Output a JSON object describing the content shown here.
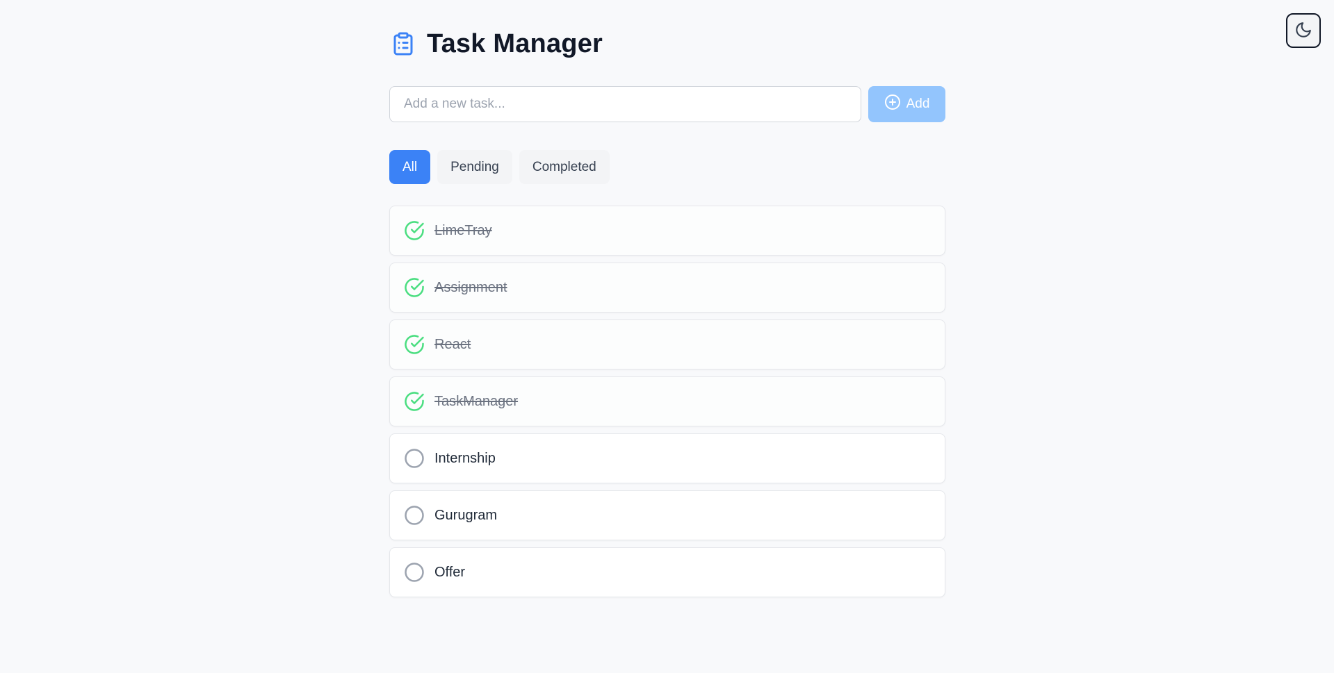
{
  "app": {
    "title": "Task Manager",
    "accent_color": "#3b82f6",
    "completed_color": "#4ade80"
  },
  "theme_toggle": {
    "icon": "moon-icon"
  },
  "add_task": {
    "placeholder": "Add a new task...",
    "value": "",
    "button_label": "Add",
    "button_icon": "plus-circle-icon"
  },
  "filters": [
    {
      "label": "All",
      "active": true
    },
    {
      "label": "Pending",
      "active": false
    },
    {
      "label": "Completed",
      "active": false
    }
  ],
  "tasks": [
    {
      "text": "LimeTray",
      "completed": true
    },
    {
      "text": "Assignment",
      "completed": true
    },
    {
      "text": "React",
      "completed": true
    },
    {
      "text": "TaskManager",
      "completed": true
    },
    {
      "text": "Internship",
      "completed": false
    },
    {
      "text": "Gurugram",
      "completed": false
    },
    {
      "text": "Offer",
      "completed": false
    }
  ]
}
